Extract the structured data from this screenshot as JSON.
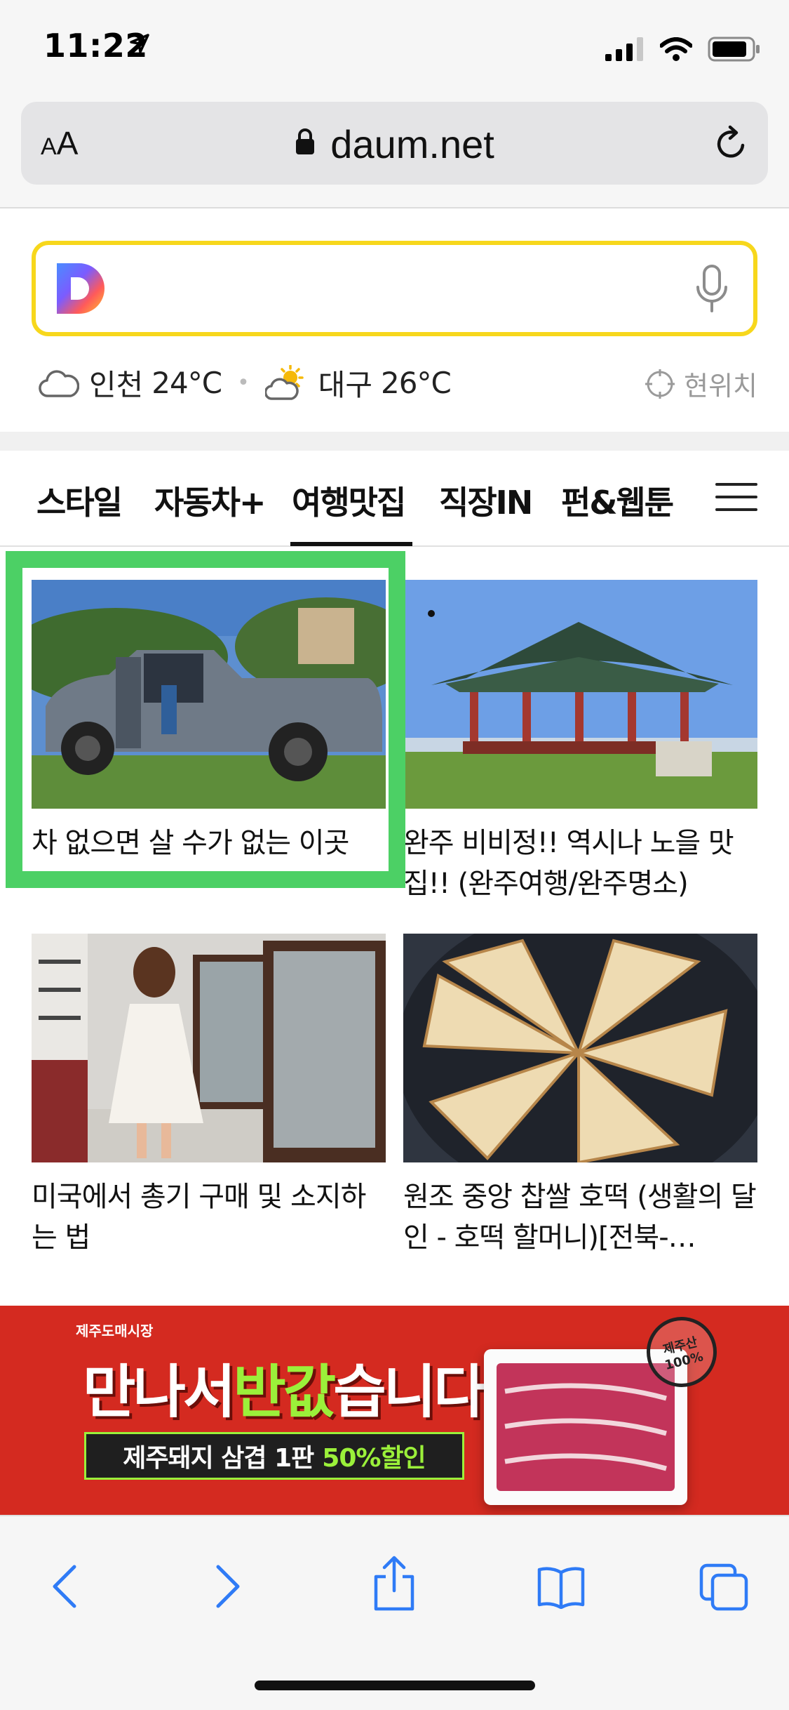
{
  "status": {
    "time": "11:22"
  },
  "browser": {
    "text_size_label": "AA",
    "url": "daum.net"
  },
  "search": {
    "placeholder": "",
    "weather": [
      {
        "city": "인천",
        "temp": "24°C",
        "icon": "cloud-icon"
      },
      {
        "city": "대구",
        "temp": "26°C",
        "icon": "sun-cloud-icon"
      }
    ],
    "location_label": "현위치"
  },
  "tabs": [
    {
      "label": "스타일",
      "active": false
    },
    {
      "label": "자동차+",
      "active": false
    },
    {
      "label": "여행맛집",
      "active": true
    },
    {
      "label": "직장IN",
      "active": false
    },
    {
      "label": "펀&웹툰",
      "active": false
    }
  ],
  "articles": [
    {
      "title": "차 없으면 살 수가 없는 이곳",
      "image": "pickup-truck-photo",
      "highlighted": true
    },
    {
      "title": "완주 비비정!! 역시나 노을 맛집!! (완주여행/완주명소)",
      "image": "pavilion-photo",
      "highlighted": false
    },
    {
      "title": "미국에서 총기 구매 및 소지하는 법",
      "image": "gun-store-photo",
      "highlighted": false
    },
    {
      "title": "원조 중앙 찹쌀 호떡 (생활의 달인 - 호떡 할머니)[전북-…",
      "image": "hotteok-photo",
      "highlighted": false
    }
  ],
  "ad": {
    "brand": "제주도매시장",
    "headline_pre": "만나서",
    "headline_accent": "반값",
    "headline_post": "습니다",
    "sub_text": "제주돼지 삼겹 1판",
    "sub_accent": "50%할인",
    "stamp": "제주산 100%"
  },
  "colors": {
    "search_border": "#f7d71c",
    "highlight_border": "#4cd065",
    "ad_background": "#d42a20",
    "ad_accent": "#9bf03a",
    "toolbar_icon": "#2f7bf6"
  }
}
